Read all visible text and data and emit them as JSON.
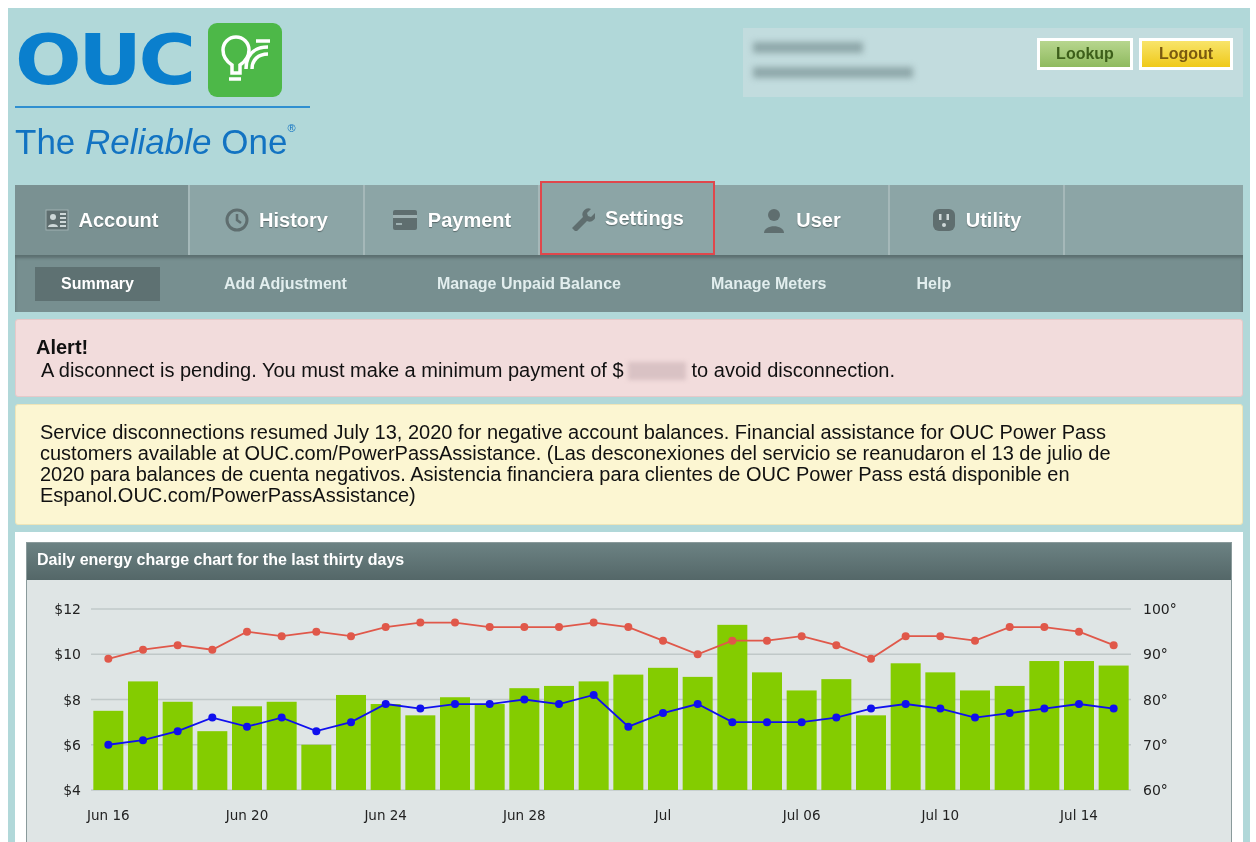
{
  "logo": {
    "text": "OUC",
    "tagline": "The *Reliable* One$^{®}$"
  },
  "header_buttons": [
    {
      "label": "Lookup",
      "kind": "lookup"
    },
    {
      "label": "Logout",
      "kind": "logout"
    }
  ],
  "tabs": [
    {
      "label": "Account",
      "selected": true,
      "highlighted": false
    },
    {
      "label": "History",
      "selected": false,
      "highlighted": false
    },
    {
      "label": "Payment",
      "selected": false,
      "highlighted": false
    },
    {
      "label": "Settings",
      "selected": false,
      "highlighted": true
    },
    {
      "label": "User",
      "selected": false,
      "highlighted": false
    },
    {
      "label": "Utility",
      "selected": false,
      "highlighted": false
    }
  ],
  "subtabs": [
    {
      "label": "Summary",
      "selected": true
    },
    {
      "label": "Add Adjustment",
      "selected": false
    },
    {
      "label": "Manage Unpaid Balance",
      "selected": false
    },
    {
      "label": "Manage Meters",
      "selected": false
    },
    {
      "label": "Help",
      "selected": false
    }
  ],
  "alert": {
    "title": "Alert!",
    "message_before": "A disconnect is pending. You must make a minimum payment of $",
    "message_after": "to avoid disconnection."
  },
  "notice": "Service disconnections resumed July 13, 2020 for negative account balances. Financial assistance for OUC Power Pass customers available at OUC.com/PowerPassAssistance. (Las desconexiones del servicio se reanudaron el 13 de julio de 2020 para balances de cuenta negativos. Asistencia financiera para clientes de OUC Power Pass está disponible en Espanol.OUC.com/PowerPassAssistance)",
  "chart": {
    "chart_data": {
      "type": "bar",
      "title": "Daily energy charge chart for the last thirty days",
      "categories": [
        "Jun 16",
        null,
        null,
        null,
        "Jun 20",
        null,
        null,
        null,
        "Jun 24",
        null,
        null,
        null,
        "Jun 28",
        null,
        null,
        null,
        "Jul",
        null,
        null,
        null,
        "Jul 06",
        null,
        null,
        null,
        "Jul 10",
        null,
        null,
        null,
        "Jul 14",
        null
      ],
      "series": [
        {
          "color": "#84cc00",
          "values": [
            7.5,
            8.8,
            7.9,
            6.6,
            7.7,
            7.9,
            6.0,
            8.2,
            7.8,
            7.3,
            8.1,
            7.8,
            8.5,
            8.6,
            8.8,
            9.1,
            9.4,
            9.0,
            11.3,
            9.2,
            8.4,
            8.9,
            7.3,
            9.6,
            9.2,
            8.4,
            8.6,
            9.7,
            9.7,
            9.5
          ]
        },
        {
          "type": "line",
          "axis": "y2",
          "marker": true,
          "color": "#e0584a",
          "values": [
            89,
            91,
            92,
            91,
            95,
            94,
            95,
            94,
            96,
            97,
            97,
            96,
            96,
            96,
            97,
            96,
            93,
            90,
            93,
            93,
            94,
            92,
            89,
            94,
            94,
            93,
            96,
            96,
            95,
            92
          ]
        },
        {
          "type": "line",
          "axis": "y2",
          "marker": true,
          "color": "#1010ee",
          "values": [
            70,
            71,
            73,
            76,
            74,
            76,
            73,
            75,
            79,
            78,
            79,
            79,
            80,
            79,
            81,
            74,
            77,
            79,
            75,
            75,
            75,
            76,
            78,
            79,
            78,
            76,
            77,
            78,
            79,
            78
          ]
        }
      ],
      "grid": true,
      "ylim": [
        4,
        12
      ],
      "yticks": [
        {
          "value": 4,
          "label": "$4"
        },
        {
          "value": 6,
          "label": "$6"
        },
        {
          "value": 8,
          "label": "$8"
        },
        {
          "value": 10,
          "label": "$10"
        },
        {
          "value": 12,
          "label": "$12"
        }
      ],
      "y2lim": [
        60,
        100
      ],
      "y2ticks": [
        {
          "value": 60,
          "label": "60°"
        },
        {
          "value": 70,
          "label": "70°"
        },
        {
          "value": 80,
          "label": "80°"
        },
        {
          "value": 90,
          "label": "90°"
        },
        {
          "value": 100,
          "label": "100°"
        }
      ]
    }
  }
}
